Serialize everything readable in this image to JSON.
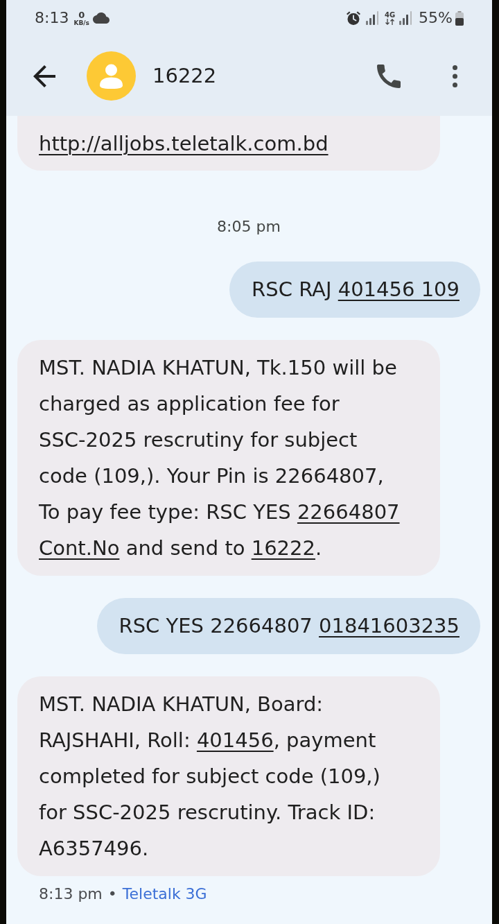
{
  "status_bar": {
    "time": "8:13",
    "speed_value": "0",
    "speed_unit": "KB/s",
    "network_type": "4G",
    "battery": "55%"
  },
  "header": {
    "contact": "16222"
  },
  "messages": [
    {
      "kind": "partial",
      "parts": [
        {
          "text": "http://alljobs.teletalk.com.bd",
          "kind": "link"
        }
      ]
    },
    {
      "kind": "timestamp",
      "text": "8:05 pm"
    },
    {
      "kind": "outgoing",
      "parts": [
        {
          "text": "RSC RAJ ",
          "kind": "text"
        },
        {
          "text": "401456 109",
          "kind": "link"
        }
      ]
    },
    {
      "kind": "incoming",
      "parts": [
        {
          "text": "MST. NADIA KHATUN, Tk.150 will be charged as application fee for SSC-2025 rescrutiny for subject code (109,). Your Pin is 22664807, To pay fee type: RSC YES ",
          "kind": "text"
        },
        {
          "text": "22664807 ",
          "kind": "link"
        },
        {
          "text": "Cont.No",
          "kind": "link"
        },
        {
          "text": " and send to ",
          "kind": "text"
        },
        {
          "text": "16222",
          "kind": "link"
        },
        {
          "text": ".",
          "kind": "text"
        }
      ]
    },
    {
      "kind": "outgoing",
      "parts": [
        {
          "text": "RSC YES 22664807 ",
          "kind": "text"
        },
        {
          "text": "01841603235",
          "kind": "link"
        }
      ]
    },
    {
      "kind": "incoming",
      "parts": [
        {
          "text": "MST. NADIA KHATUN, Board: RAJSHAHI, Roll: ",
          "kind": "text"
        },
        {
          "text": "401456",
          "kind": "link"
        },
        {
          "text": ", payment completed for subject code (109,) for SSC-2025 rescrutiny. Track ID: A6357496.",
          "kind": "text"
        }
      ]
    }
  ],
  "footer": {
    "time": "8:13 pm",
    "separator": "•",
    "carrier": "Teletalk 3G"
  }
}
